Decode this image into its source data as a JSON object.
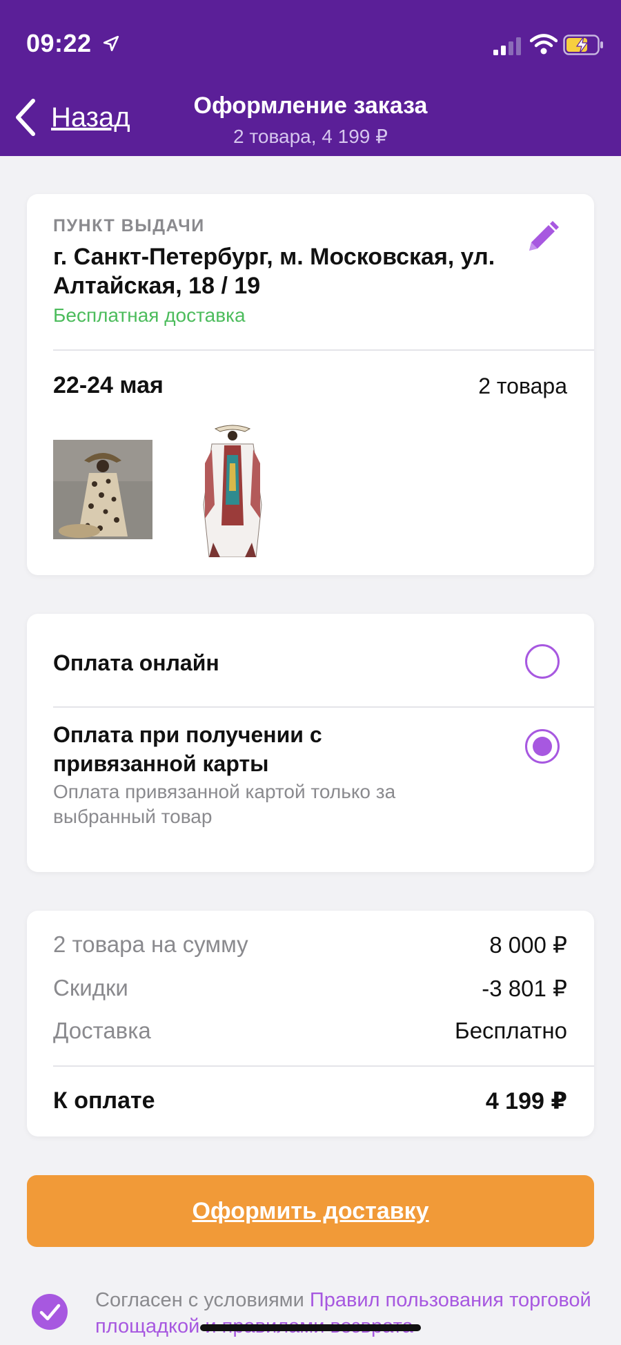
{
  "status_bar": {
    "time": "09:22"
  },
  "header": {
    "back_label": "Назад",
    "title": "Оформление заказа",
    "subtitle": "2 товара, 4 199 ₽"
  },
  "delivery": {
    "section_label": "ПУНКТ ВЫДАЧИ",
    "address": "г. Санкт-Петербург, м. Московская, ул. Алтайская, 18 / 19",
    "delivery_note": "Бесплатная доставка",
    "date": "22-24 мая",
    "items_count": "2 товара",
    "product_thumbnails": [
      "leopard-print-dress",
      "white-patterned-kaftan"
    ]
  },
  "payment": {
    "options": [
      {
        "title": "Оплата онлайн",
        "description": "",
        "selected": false
      },
      {
        "title": "Оплата при получении с привязанной карты",
        "description": "Оплата привязанной картой только за выбранный товар",
        "selected": true
      }
    ]
  },
  "summary": {
    "rows": [
      {
        "label": "2 товара на сумму",
        "value": "8 000 ₽"
      },
      {
        "label": "Скидки",
        "value": "-3 801 ₽"
      },
      {
        "label": "Доставка",
        "value": "Бесплатно"
      }
    ],
    "total_label": "К оплате",
    "total_value": "4 199 ₽"
  },
  "cta_label": "Оформить доставку",
  "agreement": {
    "prefix": "Согласен с условиями ",
    "link_text": "Правил пользования торговой площадкой и правилами возврата",
    "checked": true
  },
  "colors": {
    "header_bg": "#5b1f98",
    "accent": "#a758e0",
    "cta": "#f19a38",
    "success": "#4cbc5c"
  }
}
